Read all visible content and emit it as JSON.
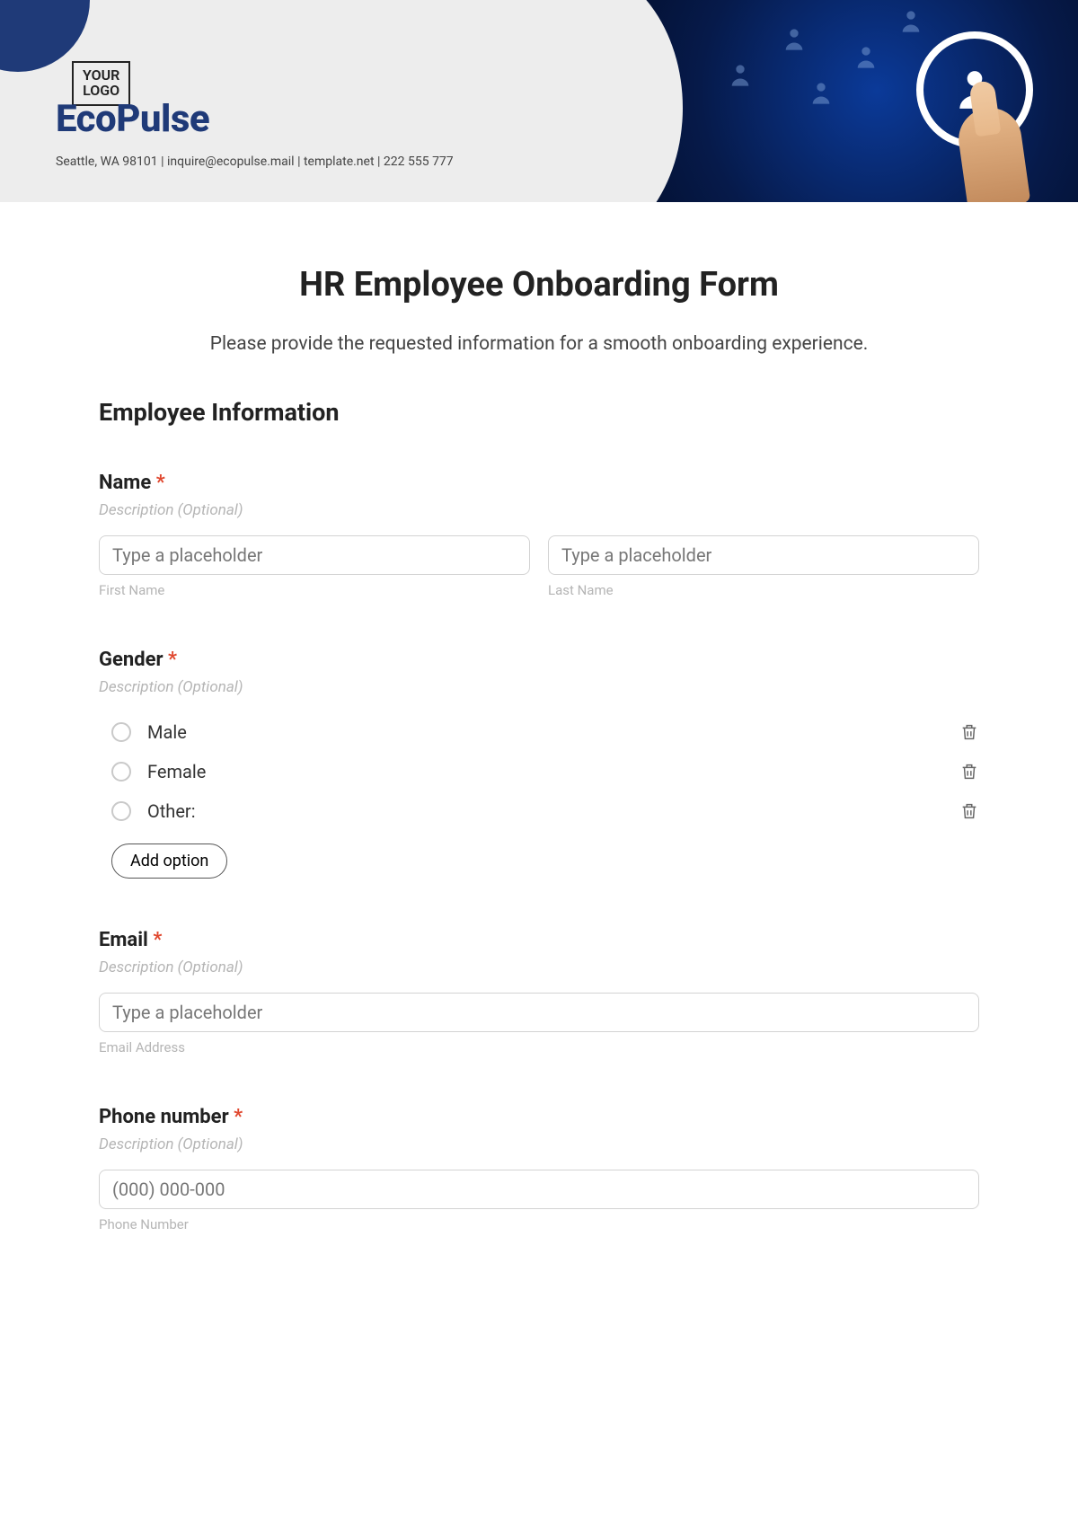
{
  "header": {
    "logo_line1": "YOUR",
    "logo_line2": "LOGO",
    "brand": "EcoPulse",
    "contact": "Seattle, WA 98101 | inquire@ecopulse.mail | template.net | 222 555 777"
  },
  "form": {
    "title": "HR Employee Onboarding Form",
    "intro": "Please provide the requested information for a smooth onboarding experience.",
    "section_heading": "Employee Information",
    "desc_placeholder": "Description (Optional)",
    "input_placeholder": "Type a placeholder",
    "name": {
      "label": "Name",
      "first_sub": "First Name",
      "last_sub": "Last Name"
    },
    "gender": {
      "label": "Gender",
      "options": [
        "Male",
        "Female",
        "Other:"
      ],
      "add_option": "Add option"
    },
    "email": {
      "label": "Email",
      "sub": "Email Address"
    },
    "phone": {
      "label": "Phone number",
      "placeholder": "(000) 000-000",
      "sub": "Phone Number"
    },
    "req": "*"
  }
}
